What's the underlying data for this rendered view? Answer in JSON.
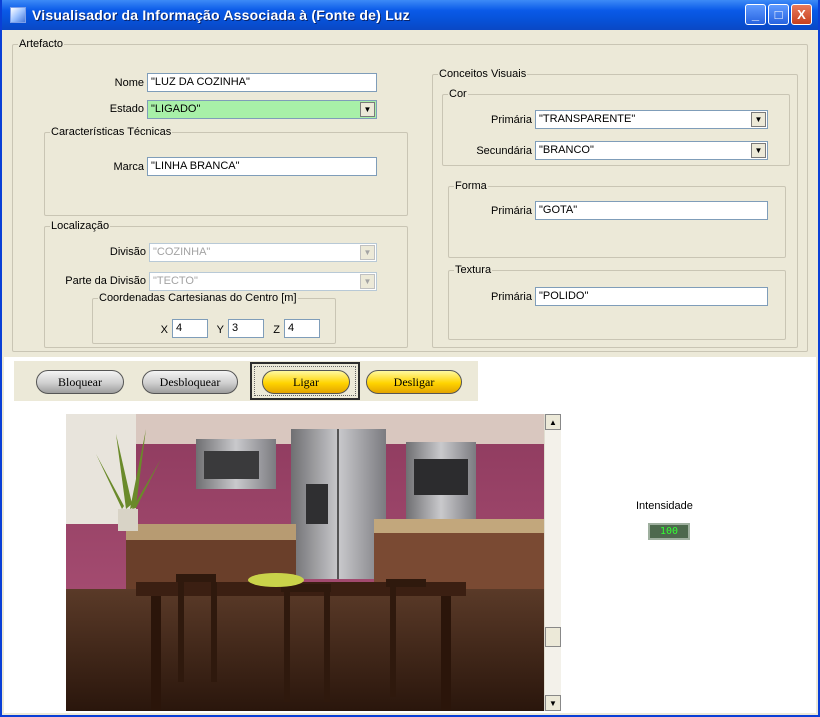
{
  "window": {
    "title": "Visualisador da Informação Associada à (Fonte de) Luz",
    "buttons": {
      "minimize": "_",
      "maximize": "□",
      "close": "X"
    }
  },
  "artefacto": {
    "legend": "Artefacto",
    "nome": {
      "label": "Nome",
      "value": "\"LUZ DA COZINHA\""
    },
    "estado": {
      "label": "Estado",
      "value": "\"LIGADO\"",
      "color": "#a8f0a8"
    },
    "caracteristicas": {
      "legend": "Características Técnicas",
      "marca": {
        "label": "Marca",
        "value": "\"LINHA BRANCA\""
      }
    },
    "localizacao": {
      "legend": "Localização",
      "divisao": {
        "label": "Divisão",
        "value": "\"COZINHA\""
      },
      "parte": {
        "label": "Parte da Divisão",
        "value": "\"TECTO\""
      },
      "coordenadas": {
        "legend": "Coordenadas Cartesianas do Centro [m]",
        "x": {
          "label": "X",
          "value": "4"
        },
        "y": {
          "label": "Y",
          "value": "3"
        },
        "z": {
          "label": "Z",
          "value": "4"
        }
      }
    }
  },
  "conceitos": {
    "legend": "Conceitos Visuais",
    "cor": {
      "legend": "Cor",
      "primaria": {
        "label": "Primária",
        "value": "\"TRANSPARENTE\""
      },
      "secundaria": {
        "label": "Secundária",
        "value": "\"BRANCO\""
      }
    },
    "forma": {
      "legend": "Forma",
      "primaria": {
        "label": "Primária",
        "value": "\"GOTA\""
      }
    },
    "textura": {
      "legend": "Textura",
      "primaria": {
        "label": "Primária",
        "value": "\"POLIDO\""
      }
    }
  },
  "actions": {
    "bloquear": "Bloquear",
    "desbloquear": "Desbloquear",
    "ligar": "Ligar",
    "desligar": "Desligar",
    "colors": {
      "grey": "#cfcfcf",
      "yellow": "#ffd400"
    }
  },
  "scrollbar": {
    "up": "▲",
    "down": "▼"
  },
  "combo_arrow": "▼",
  "intensidade": {
    "label": "Intensidade",
    "value": "100",
    "color": "#33ff33"
  },
  "photo": {
    "icon": "kitchen-photo"
  }
}
